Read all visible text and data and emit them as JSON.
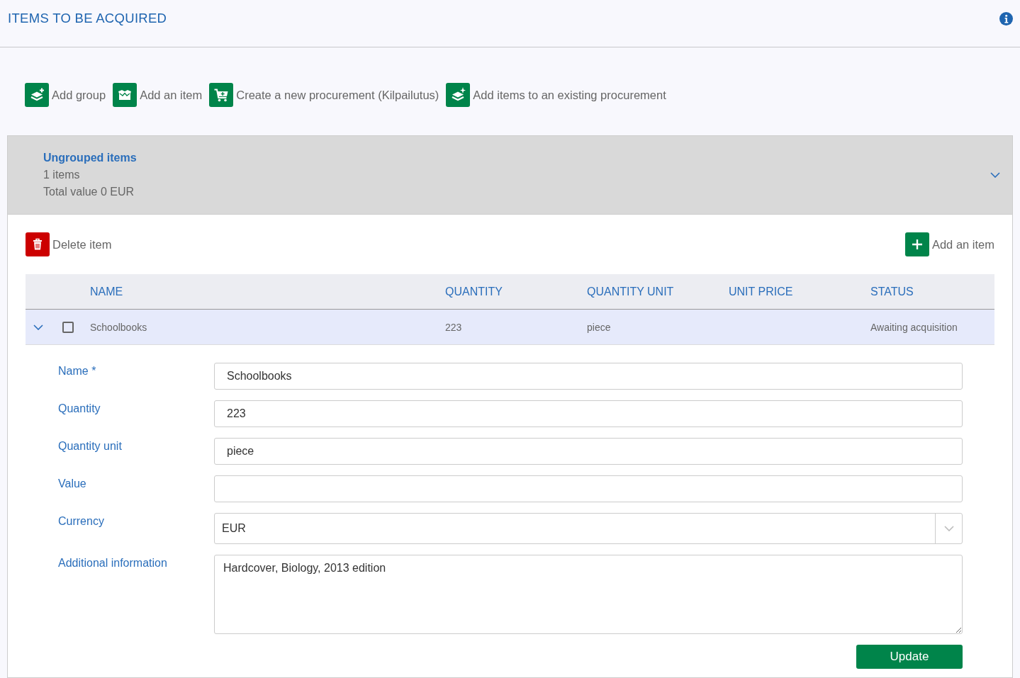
{
  "header": {
    "title": "ITEMS TO BE ACQUIRED"
  },
  "toolbar": [
    {
      "kind": "layers",
      "label": "Add group"
    },
    {
      "kind": "box",
      "label": "Add an item"
    },
    {
      "kind": "cart",
      "label": "Create a new procurement (Kilpailutus)"
    },
    {
      "kind": "stack",
      "label": "Add items to an existing procurement"
    }
  ],
  "group": {
    "title": "Ungrouped items",
    "count": "1 items",
    "total": "Total value 0 EUR",
    "expanded": true,
    "actions": [
      {
        "kind": "delete",
        "label": "Delete item"
      },
      {
        "kind": "add",
        "label": "Add an item"
      }
    ],
    "table": {
      "columns": [
        "NAME",
        "QUANTITY",
        "QUANTITY UNIT",
        "UNIT PRICE",
        "STATUS"
      ],
      "rows": [
        {
          "expanded": true,
          "checked": false,
          "name": "Schoolbooks",
          "quantity": "223",
          "quantity_unit": "piece",
          "status": "Awaiting acquisition",
          "details": {
            "fields": [
              {
                "kind": "text",
                "label": "Name *",
                "value": "Schoolbooks"
              },
              {
                "kind": "text",
                "label": "Quantity",
                "value": "223"
              },
              {
                "kind": "text",
                "label": "Quantity unit",
                "value": "piece"
              },
              {
                "kind": "text",
                "label": "Value"
              },
              {
                "kind": "select",
                "label": "Currency",
                "value": "EUR"
              },
              {
                "kind": "textarea",
                "label": "Additional information",
                "value": "Hardcover, Biology, 2013 edition"
              }
            ],
            "submit": "Update"
          }
        }
      ]
    }
  }
}
